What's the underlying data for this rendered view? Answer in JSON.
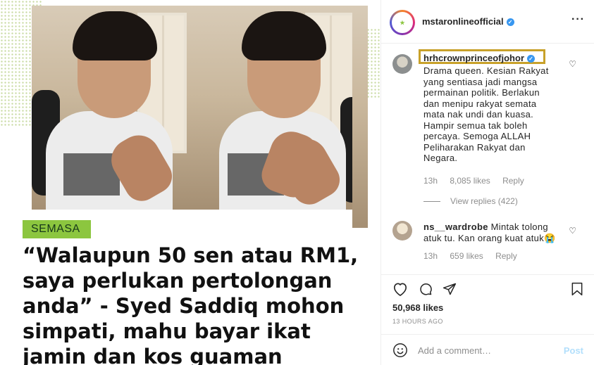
{
  "post": {
    "tag": "SEMASA",
    "headline_lines": [
      "“Walaupun 50 sen atau RM1,",
      "saya perlukan pertolongan",
      "anda” - Syed Saddiq mohon",
      "simpati, mahu bayar ikat",
      "jamin dan kos guaman"
    ],
    "tag_color": "#8cc63f"
  },
  "header": {
    "username": "mstaronlineofficial",
    "verified": true,
    "more_icon": "more-horizontal-icon"
  },
  "comments": [
    {
      "username": "hrhcrownprinceofjohor",
      "verified": true,
      "text_lines": [
        "Drama queen. Kesian Rakyat",
        "yang sentiasa jadi mangsa",
        "permainan politik. Berlakun",
        "dan menipu rakyat semata",
        "mata nak undi dan kuasa.",
        "Hampir semua tak boleh",
        "percaya. Semoga ALLAH",
        "Peliharakan Rakyat dan",
        "Negara."
      ],
      "time": "13h",
      "likes": "8,085 likes",
      "reply": "Reply",
      "view_replies": "View replies (422)"
    },
    {
      "username": "ns__wardrobe",
      "text_lines": [
        "Mintak tolong",
        "atuk tu. Kan orang kuat atuk😭"
      ],
      "first_inline": "Mintak tolong",
      "second_line": "atuk tu. Kan orang kuat atuk😭",
      "time": "13h",
      "likes": "659 likes",
      "reply": "Reply"
    }
  ],
  "actions": {
    "like_icon": "heart-icon",
    "comment_icon": "comment-icon",
    "share_icon": "share-icon",
    "save_icon": "bookmark-icon"
  },
  "likes": "50,968 likes",
  "timestamp": "13 HOURS AGO",
  "add_comment": {
    "placeholder": "Add a comment…",
    "post_label": "Post",
    "emoji_icon": "emoji-icon"
  },
  "colors": {
    "verified": "#3897f0",
    "highlight_box": "#c8a12a",
    "post_button": "#b2dffc"
  }
}
